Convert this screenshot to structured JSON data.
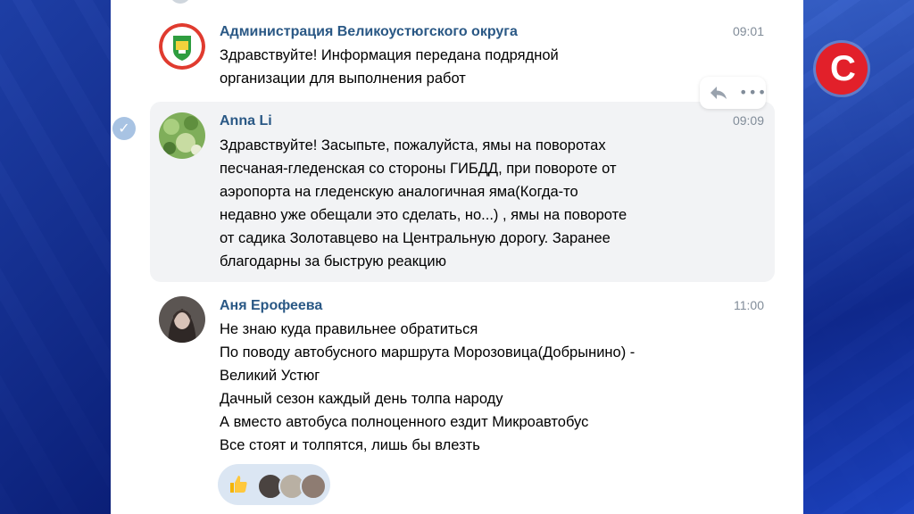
{
  "channel": {
    "logo_letter": "С"
  },
  "messages": [
    {
      "author": "Администрация Великоустюгского округа",
      "time": "09:01",
      "lines": [
        "Здравствуйте! Информация передана подрядной",
        "организации для выполнения работ"
      ]
    },
    {
      "author": "Anna Li",
      "time": "09:09",
      "lines": [
        "Здравствуйте! Засыпьте, пожалуйста, ямы на поворотах",
        "песчаная-гледенская со стороны ГИБДД, при повороте от",
        "аэропорта на гледенскую аналогичная яма(Когда-то",
        "недавно уже обещали это сделать, но...) , ямы на повороте",
        "от садика Золотавцево на Центральную дорогу. Заранее",
        "благодарны за быструю реакцию"
      ]
    },
    {
      "author": "Аня Ерофеева",
      "time": "11:00",
      "lines": [
        "Не знаю куда правильнее обратиться",
        "По поводу автобусного маршрута Морозовица(Добрынино) -",
        "Великий Устюг",
        "Дачный сезон каждый день толпа народу",
        "А вместо автобуса полноценного ездит Микроавтобус",
        "Все стоят и толпятся, лишь бы влезть"
      ]
    }
  ],
  "message_actions": {
    "reply_icon": "reply-icon",
    "more_icon": "more-icon",
    "more_glyph": "•••"
  },
  "reactions": {
    "emoji": "thumbs-up",
    "user_count": 3
  },
  "colors": {
    "author": "#2a5885",
    "time": "#818c99",
    "hover_bg": "#f2f3f5",
    "reaction_bg": "#dbe6f3",
    "channel_logo": "#e2202a"
  }
}
